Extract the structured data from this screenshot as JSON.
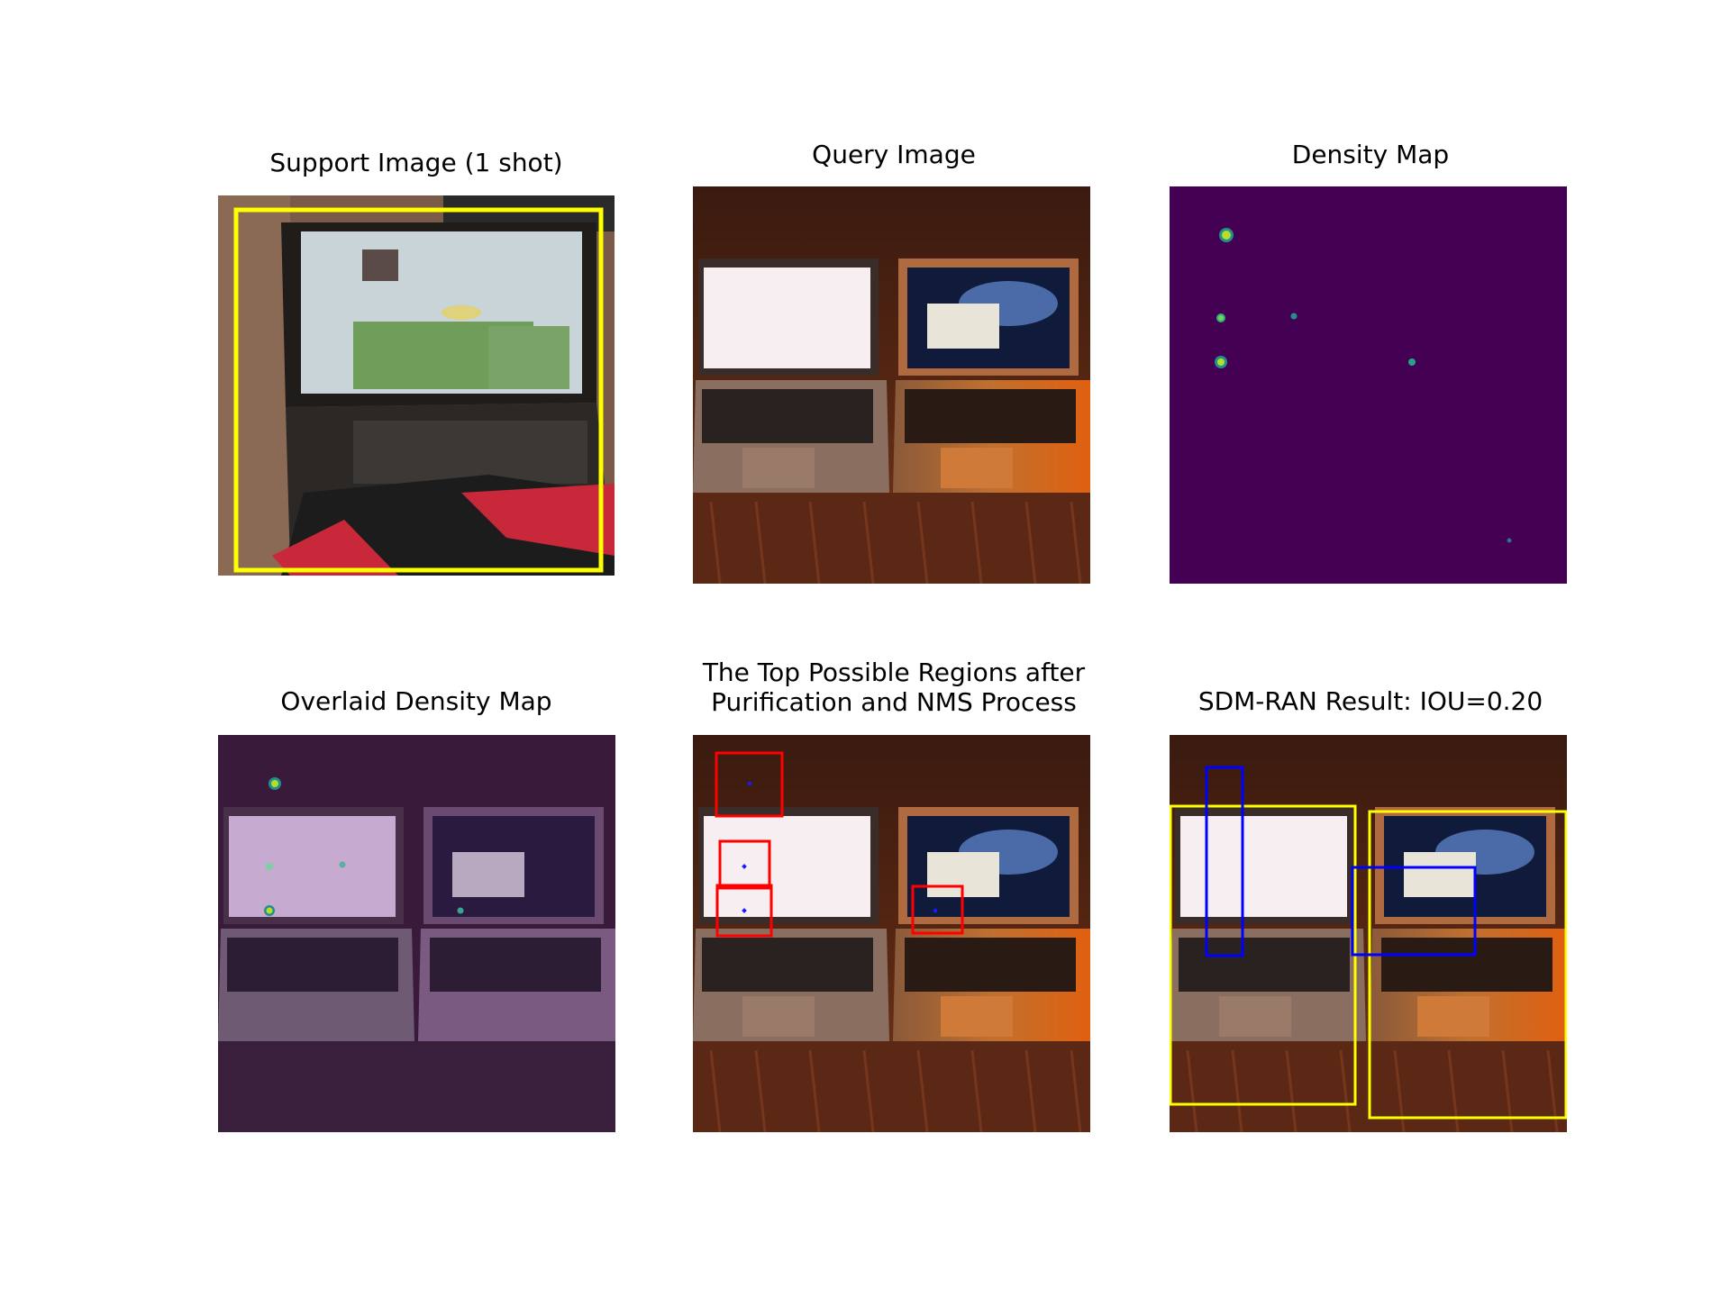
{
  "figure": {
    "panels": [
      {
        "title": "Support Image (1 shot)"
      },
      {
        "title": "Query Image"
      },
      {
        "title": "Density Map"
      },
      {
        "title": "Overlaid Density Map"
      },
      {
        "title": "The Top Possible Regions after\nPurification and NMS Process"
      },
      {
        "title": "SDM-RAN Result: IOU=0.20"
      }
    ],
    "colors": {
      "support_box": "#ffff00",
      "region_box": "#ff0000",
      "region_center": "#1a1aff",
      "prediction_box": "#0000ff",
      "ground_truth_box": "#ffff00",
      "density_background": "#440154"
    },
    "iou": 0.2
  }
}
